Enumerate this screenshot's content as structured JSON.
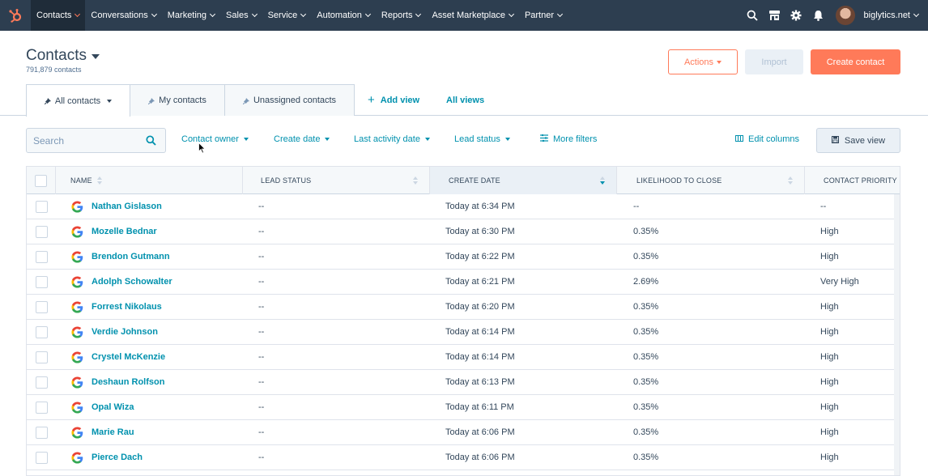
{
  "nav": {
    "items": [
      {
        "label": "Contacts",
        "active": true
      },
      {
        "label": "Conversations"
      },
      {
        "label": "Marketing"
      },
      {
        "label": "Sales"
      },
      {
        "label": "Service"
      },
      {
        "label": "Automation"
      },
      {
        "label": "Reports"
      },
      {
        "label": "Asset Marketplace"
      },
      {
        "label": "Partner"
      }
    ],
    "account": "biglytics.net"
  },
  "header": {
    "title": "Contacts",
    "subtitle": "791,879 contacts",
    "actions_label": "Actions",
    "import_label": "Import",
    "create_label": "Create contact"
  },
  "tabs": [
    {
      "label": "All contacts",
      "active": true
    },
    {
      "label": "My contacts"
    },
    {
      "label": "Unassigned contacts"
    }
  ],
  "tab_links": {
    "add_view": "Add view",
    "all_views": "All views"
  },
  "filters": {
    "search_placeholder": "Search",
    "contact_owner": "Contact owner",
    "create_date": "Create date",
    "last_activity_date": "Last activity date",
    "lead_status": "Lead status",
    "more_filters": "More filters",
    "edit_columns": "Edit columns",
    "save_view": "Save view"
  },
  "table": {
    "columns": [
      "NAME",
      "LEAD STATUS",
      "CREATE DATE",
      "LIKELIHOOD TO CLOSE",
      "CONTACT PRIORITY"
    ],
    "rows": [
      [
        "Nathan Gislason",
        "--",
        "Today at 6:34 PM",
        "--",
        "--"
      ],
      [
        "Mozelle Bednar",
        "--",
        "Today at 6:30 PM",
        "0.35%",
        "High"
      ],
      [
        "Brendon Gutmann",
        "--",
        "Today at 6:22 PM",
        "0.35%",
        "High"
      ],
      [
        "Adolph Schowalter",
        "--",
        "Today at 6:21 PM",
        "2.69%",
        "Very High"
      ],
      [
        "Forrest Nikolaus",
        "--",
        "Today at 6:20 PM",
        "0.35%",
        "High"
      ],
      [
        "Verdie Johnson",
        "--",
        "Today at 6:14 PM",
        "0.35%",
        "High"
      ],
      [
        "Crystel McKenzie",
        "--",
        "Today at 6:14 PM",
        "0.35%",
        "High"
      ],
      [
        "Deshaun Rolfson",
        "--",
        "Today at 6:13 PM",
        "0.35%",
        "High"
      ],
      [
        "Opal Wiza",
        "--",
        "Today at 6:11 PM",
        "0.35%",
        "High"
      ],
      [
        "Marie Rau",
        "--",
        "Today at 6:06 PM",
        "0.35%",
        "High"
      ],
      [
        "Pierce Dach",
        "--",
        "Today at 6:06 PM",
        "0.35%",
        "High"
      ]
    ]
  },
  "colors": {
    "nav_bg": "#2d3e50",
    "accent": "#ff7a59",
    "link": "#0091ae",
    "text": "#33475b"
  },
  "icons": [
    "hubspot-sprocket-icon",
    "search-icon",
    "marketplace-icon",
    "gear-icon",
    "bell-icon",
    "pin-icon",
    "plus-icon",
    "filter-lines-icon",
    "columns-icon",
    "disk-icon",
    "google-icon",
    "sort-icon"
  ]
}
